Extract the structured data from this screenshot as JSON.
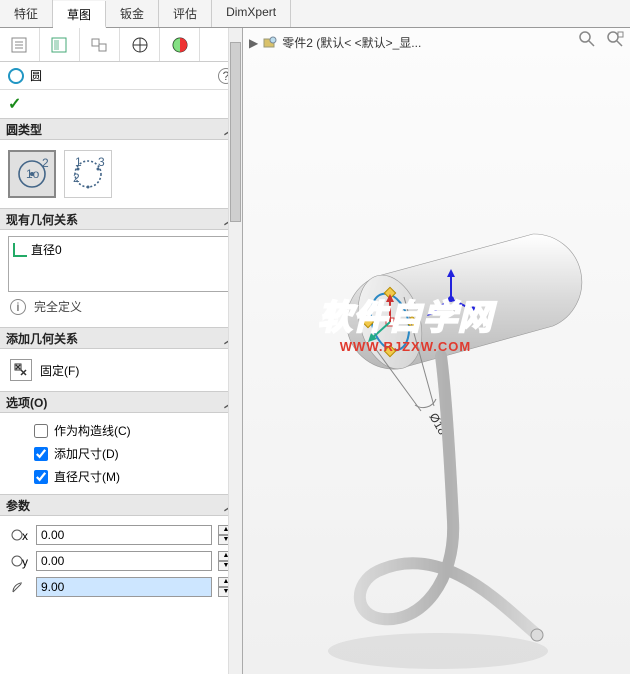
{
  "tabs": [
    "特征",
    "草图",
    "钣金",
    "评估",
    "DimXpert"
  ],
  "active_tab_index": 1,
  "feature": {
    "name": "圆"
  },
  "sections": {
    "circle_type": "圆类型",
    "existing_rel": "现有几何关系",
    "add_rel": "添加几何关系",
    "options": "选项(O)",
    "params": "参数"
  },
  "relations": {
    "items": [
      "直径0"
    ]
  },
  "status": "完全定义",
  "add_relations": {
    "fix": "固定(F)"
  },
  "options": {
    "construction": {
      "label": "作为构造线(C)",
      "checked": false
    },
    "add_dim": {
      "label": "添加尺寸(D)",
      "checked": true
    },
    "diameter_dim": {
      "label": "直径尺寸(M)",
      "checked": true
    }
  },
  "params": {
    "x": "0.00",
    "y": "0.00",
    "r": "9.00"
  },
  "breadcrumb": "零件2  (默认< <默认>_显...",
  "dim_label": "Ø18",
  "watermark": {
    "line1": "软件自学网",
    "line2": "WWW.RJZXW.COM"
  },
  "colors": {
    "accent": "#2196c3",
    "ok": "#1a8a1a",
    "wm_blue": "#2e70e0",
    "wm_red": "#e03a2e"
  }
}
